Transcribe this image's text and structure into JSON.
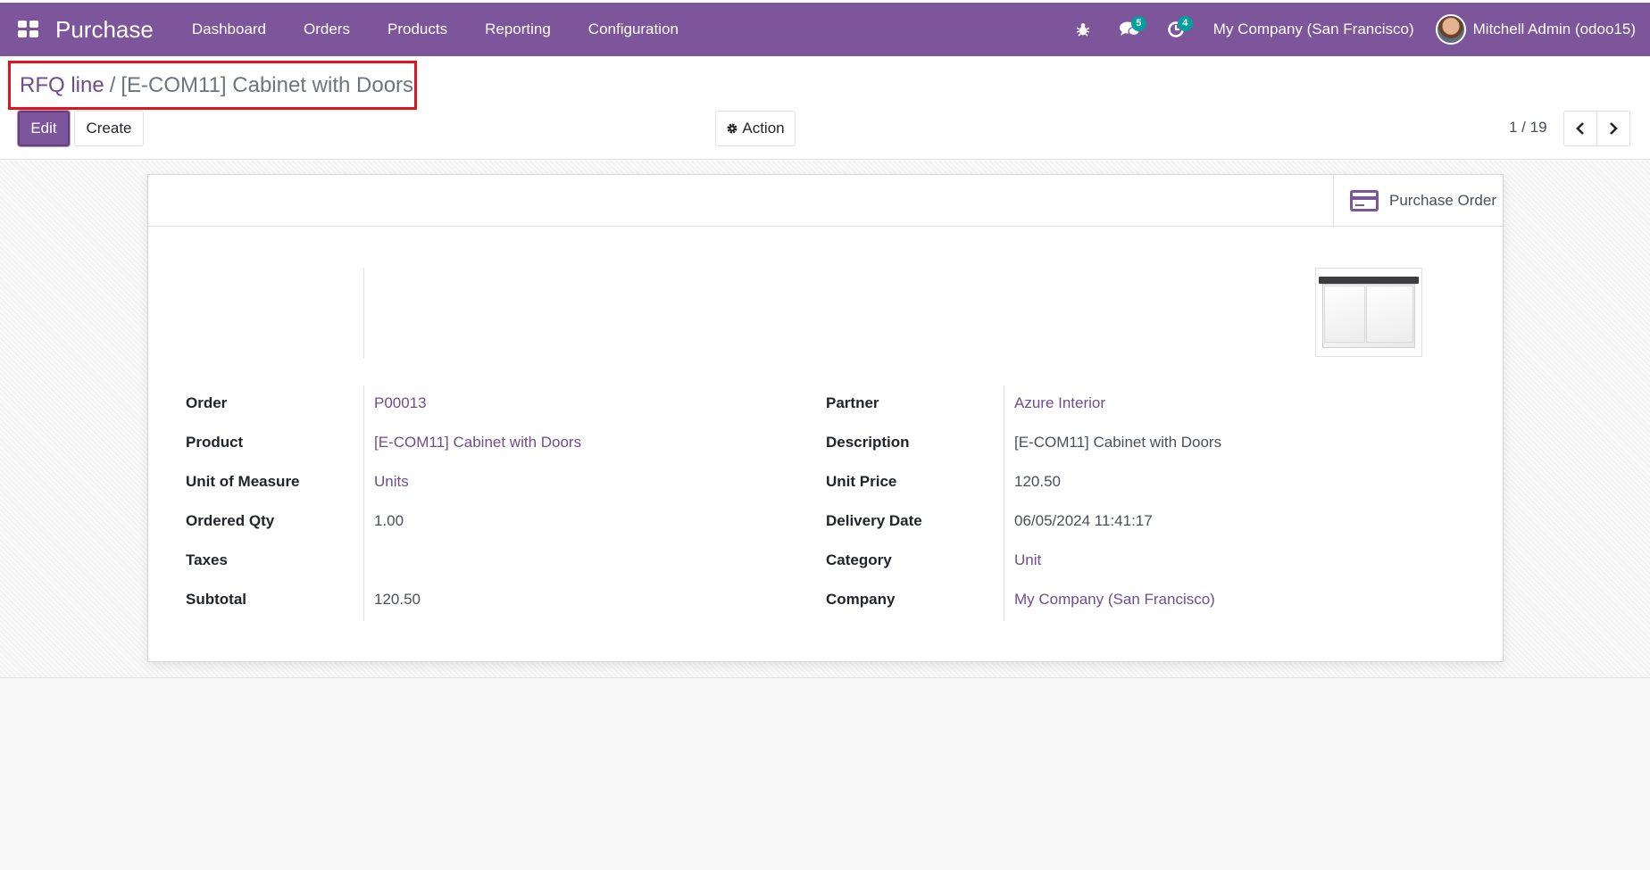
{
  "navbar": {
    "app_name": "Purchase",
    "menu": [
      "Dashboard",
      "Orders",
      "Products",
      "Reporting",
      "Configuration"
    ],
    "messages_count": "5",
    "activities_count": "4",
    "company": "My Company (San Francisco)",
    "user": "Mitchell Admin (odoo15)"
  },
  "breadcrumb": {
    "parent": "RFQ line",
    "separator": "/",
    "current": "[E-COM11] Cabinet with Doors"
  },
  "toolbar": {
    "edit_label": "Edit",
    "create_label": "Create",
    "action_label": "Action",
    "pager": "1 / 19"
  },
  "stat_button": {
    "label": "Purchase Order"
  },
  "left_fields": [
    {
      "label": "Order",
      "value": "P00013",
      "link": true
    },
    {
      "label": "Product",
      "value": "[E-COM11] Cabinet with Doors",
      "link": true
    },
    {
      "label": "Unit of Measure",
      "value": "Units",
      "link": true
    },
    {
      "label": "Ordered Qty",
      "value": "1.00",
      "link": false
    },
    {
      "label": "Taxes",
      "value": "",
      "link": false
    },
    {
      "label": "Subtotal",
      "value": "120.50",
      "link": false
    }
  ],
  "right_fields": [
    {
      "label": "Partner",
      "value": "Azure Interior",
      "link": true
    },
    {
      "label": "Description",
      "value": "[E-COM11] Cabinet with Doors",
      "link": false
    },
    {
      "label": "Unit Price",
      "value": "120.50",
      "link": false
    },
    {
      "label": "Delivery Date",
      "value": "06/05/2024 11:41:17",
      "link": false
    },
    {
      "label": "Category",
      "value": "Unit",
      "link": true
    },
    {
      "label": "Company",
      "value": "My Company (San Francisco)",
      "link": true
    }
  ],
  "colors": {
    "brand": "#7c559a",
    "link": "#714b8f",
    "highlight_box": "#e0141e"
  }
}
